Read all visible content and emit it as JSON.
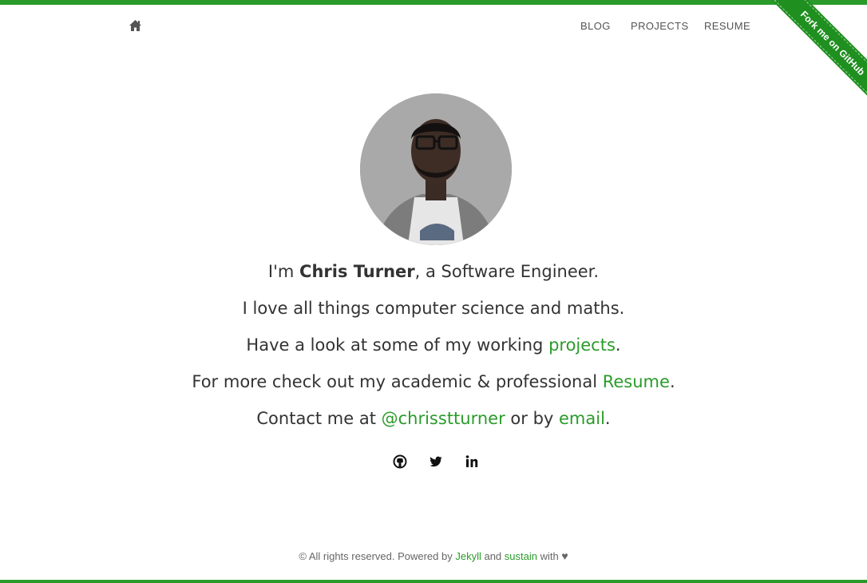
{
  "nav": {
    "home_icon": "home-icon",
    "items": [
      {
        "label": "BLOG"
      },
      {
        "label": "PROJECTS"
      },
      {
        "label": "RESUME"
      }
    ]
  },
  "ribbon": {
    "label": "Fork me on GitHub"
  },
  "avatar": {
    "alt": "Chris Turner"
  },
  "bio": {
    "line1": {
      "prefix": "I'm ",
      "name": "Chris Turner",
      "suffix": ", a Software Engineer."
    },
    "line2": {
      "text": "I love all things computer science and maths."
    },
    "line3": {
      "prefix": "Have a look at some of my working ",
      "link": "projects",
      "suffix": "."
    },
    "line4": {
      "prefix": "For more check out my academic & professional ",
      "link": "Resume",
      "suffix": "."
    },
    "line5": {
      "prefix": "Contact me at ",
      "twitter_link": "@chrisstturner",
      "middle": " or by ",
      "email_link": "email",
      "suffix": "."
    }
  },
  "social": {
    "icons": [
      "github-icon",
      "twitter-icon",
      "linkedin-icon"
    ]
  },
  "footer": {
    "prefix": "© All rights reserved. Powered by ",
    "jekyll_link": "Jekyll",
    "and": " and ",
    "sustain_link": "sustain",
    "with": " with ",
    "heart": "♥"
  },
  "colors": {
    "accent": "#2a9b2a",
    "text": "#333333",
    "nav_text": "#555555",
    "footer_text": "#666666"
  }
}
